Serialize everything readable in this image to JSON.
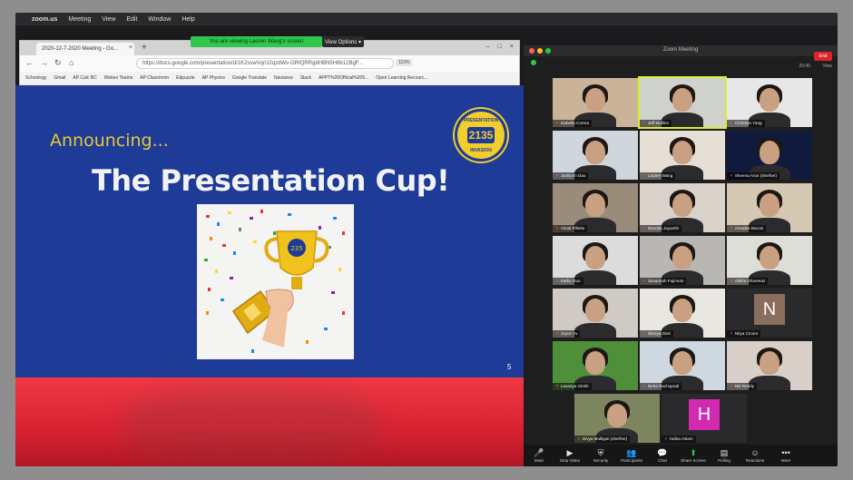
{
  "menubar": {
    "app": "zoom.us",
    "items": [
      "Meeting",
      "View",
      "Edit",
      "Window",
      "Help"
    ]
  },
  "share_banner": {
    "text": "You are viewing Lauren Wang's screen",
    "view_options": "View Options ▾"
  },
  "browser": {
    "tab_title": "2020-12-7-2020 Meeting - Go...",
    "url": "https://docs.google.com/presentation/d/1K2sswVqrU2qzdWv-GRtQRRgdHBN5H8b12BgF...",
    "zoom": "110%",
    "bookmarks": [
      "Schoology",
      "Gmail",
      "AP Calc BC",
      "Webex Teams",
      "AP Classroom",
      "Edpuzzle",
      "AP Physics",
      "Google Translate",
      "Naviance",
      "Slack",
      "APPT%20Official%205...",
      "Open Learning Recourc..."
    ]
  },
  "slide": {
    "announce": "Announcing...",
    "title": "The Presentation Cup!",
    "number": "5",
    "logo_text_top": "PRESENTATION",
    "logo_text_center": "2135",
    "logo_text_bottom": "INVASION",
    "logo_colors": {
      "gold": "#f2ce2a",
      "blue": "#1d3b97"
    }
  },
  "zoom": {
    "window_title": "Zoom Meeting",
    "clock": "20:45",
    "view_label": "View",
    "participants": [
      {
        "name": "Isabella Correa",
        "mic_muted": false,
        "kind": "video",
        "bg": "#c9b49a"
      },
      {
        "name": "Jeff Mullins",
        "mic_muted": false,
        "kind": "video",
        "bg": "#cfd1cc",
        "active": true
      },
      {
        "name": "Christine Yang",
        "mic_muted": false,
        "kind": "video",
        "bg": "#e7e7e7"
      },
      {
        "name": "Jacklynn Dao",
        "mic_muted": false,
        "kind": "video",
        "bg": "#cfd6dc"
      },
      {
        "name": "Lauren Wang",
        "mic_muted": false,
        "kind": "video",
        "bg": "#e5dfd6"
      },
      {
        "name": "Sheena Arun (she/her)",
        "mic_muted": false,
        "kind": "video",
        "bg": "#0f1a3c"
      },
      {
        "name": "Vinati Pilletla",
        "mic_muted": false,
        "kind": "video",
        "bg": "#9a8c7b"
      },
      {
        "name": "Nandita Jayanthi",
        "mic_muted": false,
        "kind": "video",
        "bg": "#d9d3cc"
      },
      {
        "name": "Annalee Barosi",
        "mic_muted": false,
        "kind": "video",
        "bg": "#d5c9b4"
      },
      {
        "name": "Kathy Guo",
        "mic_muted": false,
        "kind": "video",
        "bg": "#dcdcdc"
      },
      {
        "name": "Savannah Fujimoto",
        "mic_muted": false,
        "kind": "video",
        "bg": "#b9b7b3"
      },
      {
        "name": "Alisha Shareeaz",
        "mic_muted": false,
        "kind": "video",
        "bg": "#deded9"
      },
      {
        "name": "Joyce Yu",
        "mic_muted": false,
        "kind": "video",
        "bg": "#cfcac3"
      },
      {
        "name": "Shreya Dixit",
        "mic_muted": false,
        "kind": "video",
        "bg": "#e9e7e2"
      },
      {
        "name": "Nitya Cmore",
        "mic_muted": false,
        "kind": "initial",
        "initial": "N",
        "bg": "#8a6d5a"
      },
      {
        "name": "Lavanya Girish",
        "mic_muted": false,
        "kind": "video",
        "bg": "#4f8f3a"
      },
      {
        "name": "Neha Rachapudi",
        "mic_muted": false,
        "kind": "video",
        "bg": "#cfd7e0"
      },
      {
        "name": "Niti Reddy",
        "mic_muted": false,
        "kind": "video",
        "bg": "#d9cfc9"
      },
      {
        "name": "Divya Mulliguti (she/her)",
        "mic_muted": false,
        "kind": "video",
        "bg": "#7d8560"
      },
      {
        "name": "Hafsa Aslam",
        "mic_muted": true,
        "kind": "initial",
        "initial": "H",
        "bg": "#d12ab0"
      }
    ],
    "controls": [
      {
        "label": "Mute",
        "icon": "🎤",
        "name": "mute"
      },
      {
        "label": "Stop Video",
        "icon": "▶",
        "name": "stop-video"
      },
      {
        "label": "Security",
        "icon": "⛨",
        "name": "security"
      },
      {
        "label": "Participants",
        "icon": "👥",
        "name": "participants"
      },
      {
        "label": "Chat",
        "icon": "💬",
        "name": "chat"
      },
      {
        "label": "Share Screen",
        "icon": "⬆",
        "name": "share-screen"
      },
      {
        "label": "Polling",
        "icon": "▤",
        "name": "polling"
      },
      {
        "label": "Reactions",
        "icon": "☺",
        "name": "reactions"
      },
      {
        "label": "More",
        "icon": "•••",
        "name": "more"
      }
    ],
    "end_label": "End"
  }
}
